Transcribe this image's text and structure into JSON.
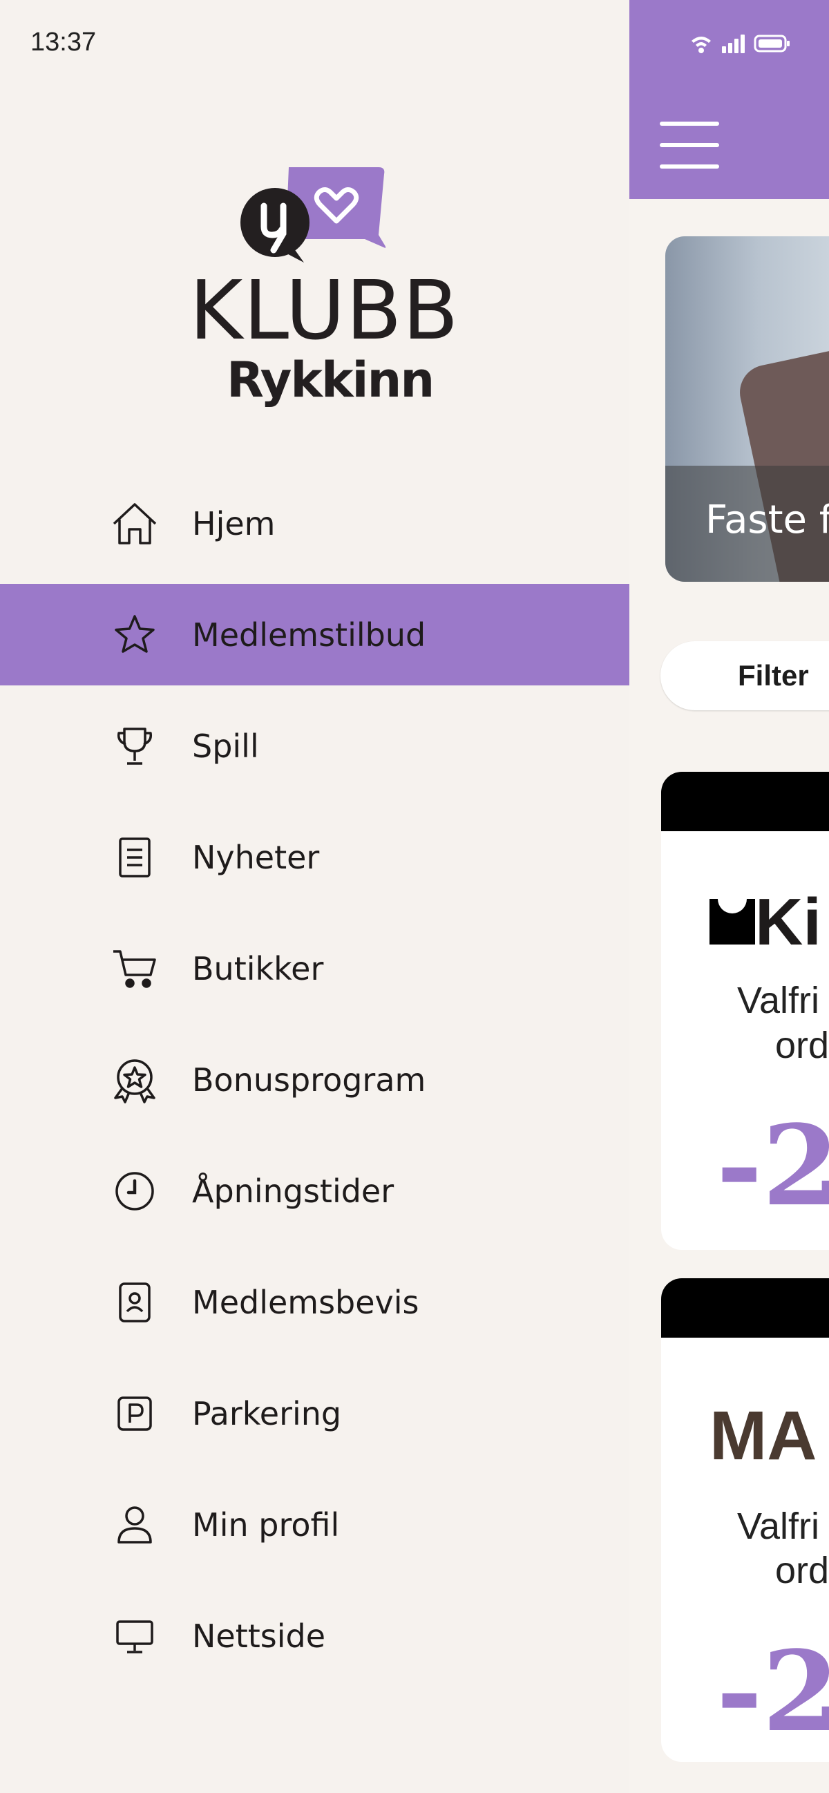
{
  "status_bar": {
    "time": "13:37"
  },
  "logo": {
    "wordmark": "KLUBB",
    "brand": "Rykkinn"
  },
  "menu": {
    "items": [
      {
        "label": "Hjem",
        "icon": "home-icon",
        "active": false
      },
      {
        "label": "Medlemstilbud",
        "icon": "star-icon",
        "active": true
      },
      {
        "label": "Spill",
        "icon": "trophy-icon",
        "active": false
      },
      {
        "label": "Nyheter",
        "icon": "document-icon",
        "active": false
      },
      {
        "label": "Butikker",
        "icon": "cart-icon",
        "active": false
      },
      {
        "label": "Bonusprogram",
        "icon": "badge-icon",
        "active": false
      },
      {
        "label": "Åpningstider",
        "icon": "clock-icon",
        "active": false
      },
      {
        "label": "Medlemsbevis",
        "icon": "member-card-icon",
        "active": false
      },
      {
        "label": "Parkering",
        "icon": "parking-icon",
        "active": false
      },
      {
        "label": "Min profil",
        "icon": "person-icon",
        "active": false
      },
      {
        "label": "Nettside",
        "icon": "monitor-icon",
        "active": false
      }
    ]
  },
  "main": {
    "hero_title": "Faste f",
    "filter_label": "Filter",
    "cards": [
      {
        "logo": "Ki",
        "line1": "Valfri",
        "line2": "ord",
        "discount": "-2"
      },
      {
        "logo": "MA",
        "line1": "Valfri",
        "line2": "ord",
        "discount": "-2"
      }
    ]
  },
  "colors": {
    "accent": "#9b79c9",
    "background": "#f6f2ee",
    "text": "#1e1b1b"
  }
}
